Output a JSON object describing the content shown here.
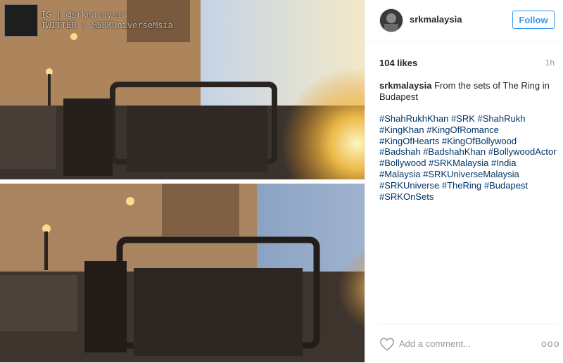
{
  "header": {
    "username": "srkmalaysia",
    "follow_label": "Follow"
  },
  "media": {
    "watermark_line1": "IG | @srkmalaysia",
    "watermark_line2": "TWITTER | @SRKUniverseMsia"
  },
  "post": {
    "likes": "104 likes",
    "time_ago": "1h",
    "caption_user": "srkmalaysia",
    "caption_text": "From the sets of The Ring in Budapest",
    "hashtags": [
      "#ShahRukhKhan",
      "#SRK",
      "#ShahRukh",
      "#KingKhan",
      "#KingOfRomance",
      "#KingOfHearts",
      "#KingOfBollywood",
      "#Badshah",
      "#BadshahKhan",
      "#BollywoodActor",
      "#Bollywood",
      "#SRKMalaysia",
      "#India",
      "#Malaysia",
      "#SRKUniverseMalaysia",
      "#SRKUniverse",
      "#TheRing",
      "#Budapest",
      "#SRKOnSets"
    ]
  },
  "comment": {
    "placeholder": "Add a comment...",
    "more_glyph": "ooo"
  },
  "colors": {
    "accent": "#3897f0",
    "hashtag": "#003569",
    "muted": "#999999"
  },
  "icons": [
    "heart-icon",
    "more-options-icon"
  ]
}
